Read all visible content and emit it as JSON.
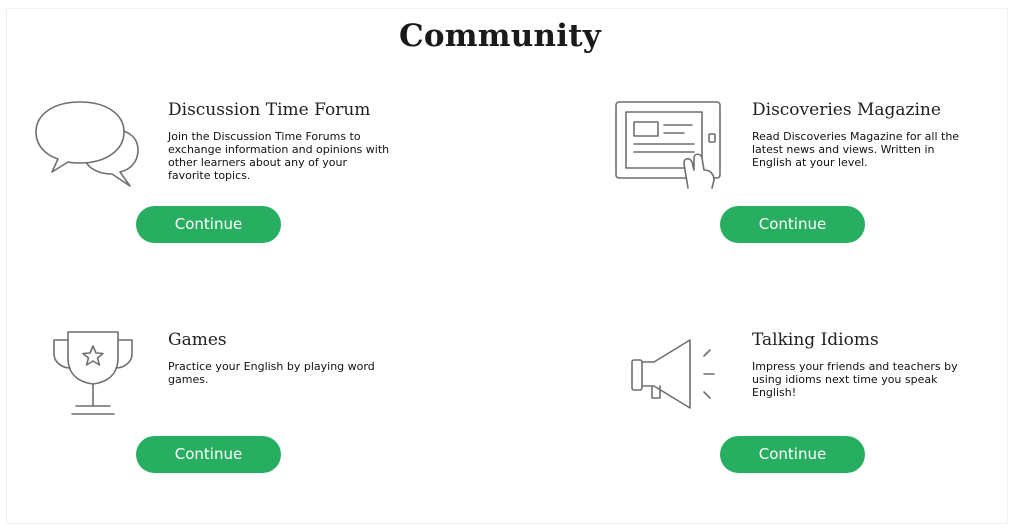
{
  "page": {
    "title": "Community"
  },
  "cards": {
    "forum": {
      "icon": "speech-bubbles-icon",
      "title": "Discussion Time Forum",
      "description": "Join the Discussion Time Forums to exchange information and opinions with other learners about any of your favorite topics.",
      "button_label": "Continue"
    },
    "magazine": {
      "icon": "tablet-touch-icon",
      "title": "Discoveries Magazine",
      "description": "Read Discoveries Magazine for all the latest news and views. Written in English at your level.",
      "button_label": "Continue"
    },
    "games": {
      "icon": "trophy-icon",
      "title": "Games",
      "description": "Practice your English by playing word games.",
      "button_label": "Continue"
    },
    "idioms": {
      "icon": "megaphone-icon",
      "title": "Talking Idioms",
      "description": "Impress your friends and teachers by using idioms next time you speak English!",
      "button_label": "Continue"
    }
  },
  "colors": {
    "button": "#27ae60",
    "icon_stroke": "#6f6f6f"
  }
}
